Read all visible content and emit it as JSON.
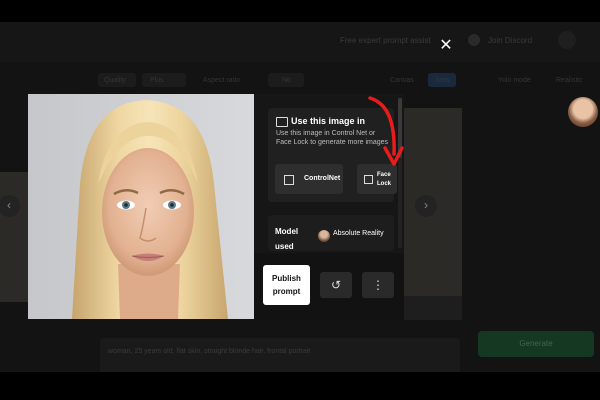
{
  "background": {
    "free_banner": "Free expert prompt assist",
    "discord": "Join Discord",
    "toolbar": [
      "Quality",
      "Plus",
      "Aspect ratio",
      "No",
      "Canvas",
      "New",
      "Yolo mode",
      "Realistic"
    ],
    "prompt_text": "woman, 25 years old, flat skin, straight blonde hair, frontal portrait",
    "generate_label": "Generate"
  },
  "modal": {
    "close_icon": "close-icon",
    "prev_icon": "chevron-left-icon",
    "next_icon": "chevron-right-icon",
    "use_image": {
      "title": "Use this image in",
      "description": "Use this image in Control Net or Face Lock to generate more images",
      "controlnet_label": "ControlNet",
      "facelock_label": "Face Lock"
    },
    "model": {
      "label": "Model used",
      "name": "Absolute Reality"
    },
    "actions": {
      "publish_label": "Publish prompt",
      "undo_icon": "undo-icon",
      "more_icon": "more-vertical-icon"
    }
  },
  "colors": {
    "overlay": "#131313",
    "panel": "#161616",
    "card": "#202020",
    "button": "#2e2e2e",
    "publish": "#ffffff",
    "arrow": "#e51d1d",
    "generate": "#143822"
  }
}
